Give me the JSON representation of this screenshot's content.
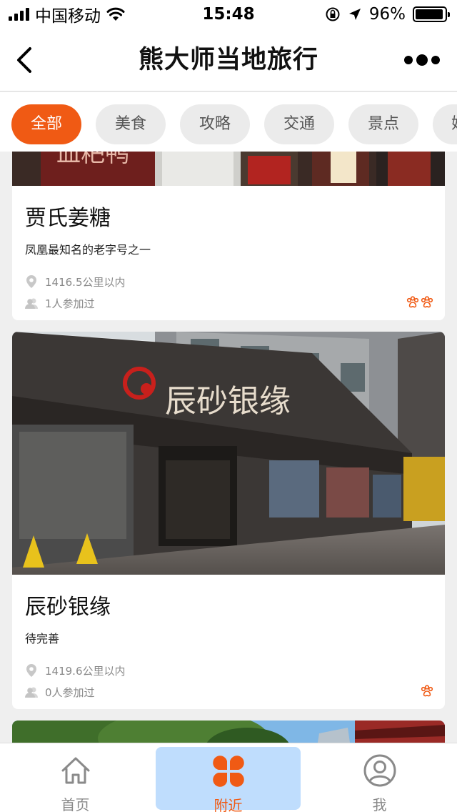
{
  "status_bar": {
    "carrier": "中国移动",
    "time": "15:48",
    "battery_text": "96%",
    "battery_level": 0.96
  },
  "nav": {
    "title": "熊大师当地旅行",
    "back_icon": "chevron-left-icon",
    "more_icon": "more-dots-icon"
  },
  "tabs": [
    {
      "label": "全部",
      "active": true
    },
    {
      "label": "美食",
      "active": false
    },
    {
      "label": "攻略",
      "active": false
    },
    {
      "label": "交通",
      "active": false
    },
    {
      "label": "景点",
      "active": false
    },
    {
      "label": "娱",
      "active": false
    }
  ],
  "cards": [
    {
      "title": "贾氏姜糖",
      "description": "凤凰最知名的老字号之一",
      "distance": "1416.5公里以内",
      "participants": "1人参加过",
      "paw_count": 2,
      "photo_sign_text": "血粑鸭"
    },
    {
      "title": "辰砂银缘",
      "description": "待完善",
      "distance": "1419.6公里以内",
      "participants": "0人参加过",
      "paw_count": 1,
      "photo_sign_text": "辰砂银缘"
    }
  ],
  "bottom_nav": [
    {
      "label": "首页",
      "icon": "home-icon",
      "active": false
    },
    {
      "label": "附近",
      "icon": "clover-icon",
      "active": true
    },
    {
      "label": "我",
      "icon": "user-icon",
      "active": false
    }
  ],
  "colors": {
    "accent": "#f05a14",
    "active_tab_bg": "#bfddfd"
  }
}
